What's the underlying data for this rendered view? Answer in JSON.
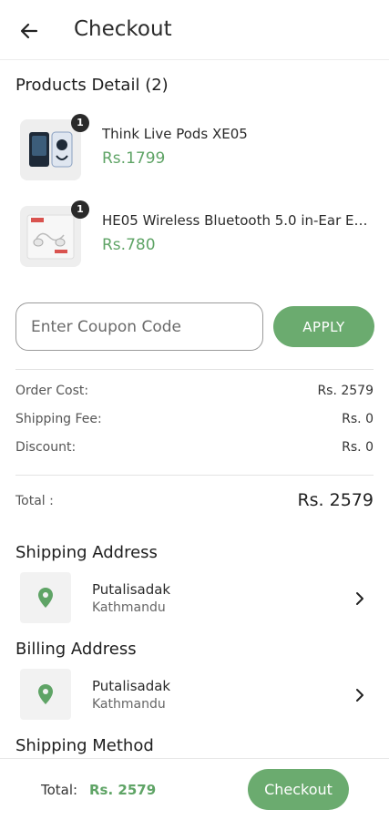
{
  "header": {
    "title": "Checkout",
    "back_icon": "arrow-left-icon"
  },
  "products": {
    "title": "Products Detail (2)",
    "items": [
      {
        "name": "Think Live Pods XE05",
        "price": "Rs.1799",
        "qty": "1"
      },
      {
        "name": "HE05 Wireless Bluetooth 5.0 in-Ear Earphone",
        "price": "Rs.780",
        "qty": "1"
      }
    ]
  },
  "coupon": {
    "placeholder": "Enter Coupon Code",
    "apply_label": "APPLY"
  },
  "summary": {
    "order_cost_label": "Order Cost:",
    "order_cost": "Rs. 2579",
    "shipping_label": "Shipping Fee:",
    "shipping": "Rs. 0",
    "discount_label": "Discount:",
    "discount": "Rs. 0",
    "total_label": "Total :",
    "total": "Rs. 2579"
  },
  "shipping_address": {
    "title": "Shipping Address",
    "line1": "Putalisadak",
    "line2": "Kathmandu"
  },
  "billing_address": {
    "title": "Billing Address",
    "line1": "Putalisadak",
    "line2": "Kathmandu"
  },
  "shipping_method": {
    "title": "Shipping Method"
  },
  "bottom_bar": {
    "total_label": "Total:",
    "total_value": "Rs. 2579",
    "checkout_label": "Checkout"
  },
  "colors": {
    "accent": "#6bab6f",
    "price": "#5fa466"
  }
}
